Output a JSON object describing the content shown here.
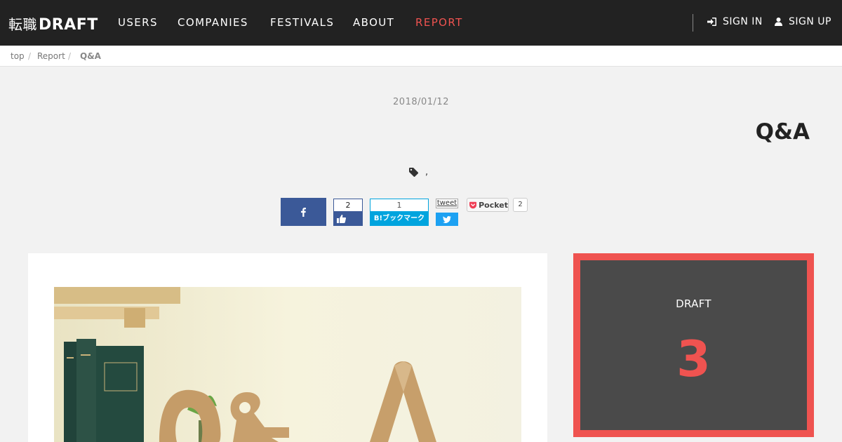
{
  "header": {
    "logo_jp": "転職",
    "logo_en": "DRAFT",
    "nav": [
      {
        "label": "USERS"
      },
      {
        "label": "COMPANIES"
      },
      {
        "label": "FESTIVALS"
      },
      {
        "label": "ABOUT"
      },
      {
        "label": "REPORT"
      }
    ],
    "sign_in": "SIGN IN",
    "sign_up": "SIGN UP",
    "active_color": "#ef5350"
  },
  "breadcrumb": {
    "items": [
      "top",
      "Report",
      "Q&A"
    ],
    "separator": "/"
  },
  "article": {
    "date": "2018/01/12",
    "title": "Q&A",
    "tags_text": ","
  },
  "share": {
    "facebook_icon": "facebook-icon",
    "like_count": "2",
    "hatena_count": "1",
    "hatena_label": "B!ブックマーク",
    "tweet_label": "tweet",
    "pocket_label": "Pocket",
    "pocket_count": "2"
  },
  "sidebar": {
    "widget_label": "DRAFT",
    "widget_count": "3",
    "accent": "#ef5350"
  }
}
